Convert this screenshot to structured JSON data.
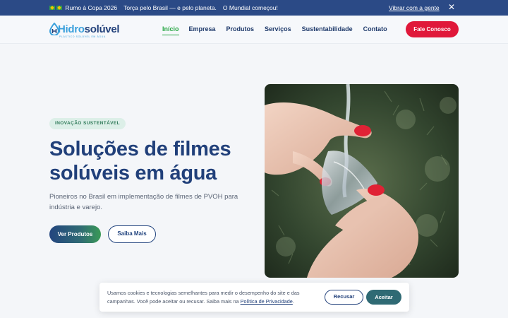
{
  "promo": {
    "flag_icon": "brazil-flag-icon",
    "items": [
      "Rumo à Copa 2026",
      "Torça pelo Brasil — e pelo planeta.",
      "O Mundial começou!"
    ],
    "link": "Vibrar com a gente",
    "close_icon": "close-icon"
  },
  "header": {
    "logo_part1": "Hidro",
    "logo_part2": "solúvel",
    "logo_tagline": "PLÁSTICO SOLÚVEL EM ÁGUA",
    "nav": [
      "Início",
      "Empresa",
      "Produtos",
      "Serviços",
      "Sustentabilidade",
      "Contato"
    ],
    "active_nav": "Início",
    "cta": "Fale Conosco"
  },
  "hero": {
    "badge": "INOVAÇÃO SUSTENTÁVEL",
    "title": "Soluções de filmes solúveis em água",
    "subtitle": "Pioneiros no Brasil em implementação de filmes de PVOH para indústria e varejo.",
    "primary_button": "Ver Produtos",
    "secondary_button": "Saiba Mais",
    "image_alt": "hands-dissolving-film-photo"
  },
  "cookie": {
    "text": "Usamos cookies e tecnologias semelhantes para medir o desempenho do site e das campanhas. Você pode aceitar ou recusar. Saiba mais na ",
    "link": "Política de Privacidade",
    "end": ".",
    "reject": "Recusar",
    "accept": "Aceitar"
  },
  "colors": {
    "promo_bg": "#2b4a86",
    "brand_navy": "#21407a",
    "brand_green": "#28a745",
    "cta_red": "#e0183a"
  }
}
